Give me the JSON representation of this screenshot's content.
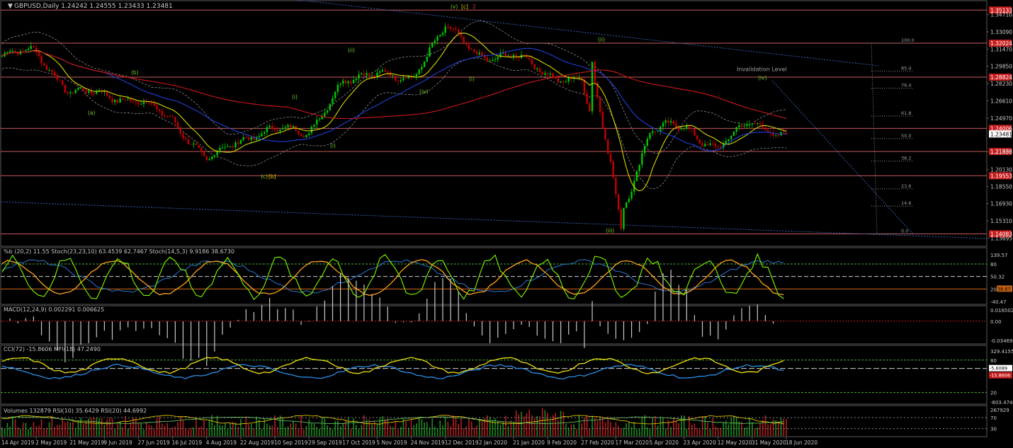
{
  "colors": {
    "background": "#000000",
    "frame": "#5a5a5a",
    "text": "#c8c8c8",
    "level_line": "#c85a5a",
    "level_label_bg": "#c81e1e",
    "price_tag_bg": "#ffffff",
    "price_tag_fg": "#000000",
    "bull_candle": "#00c800",
    "bear_candle": "#c80000",
    "ma_fast": "#d9d900",
    "ma_mid": "#2040d8",
    "ma_slow": "#d01818",
    "trendline": "#3a5fb4",
    "bollinger": "#a0a0a0",
    "stoch_main": "#ffa31a",
    "stoch_fast": "#7cfc00",
    "bband_pct": "#2a78d0",
    "ob_os_line": "#4caf2f",
    "macd_hist": "#c8c8c8",
    "macd_signal": "#d01818",
    "cci": "#2a8fe8",
    "mfi": "#f0e010",
    "vol_green": "#1e8c1e",
    "vol_red": "#b41e1e",
    "wave_label": "#79c92e",
    "wave_label_bracket": "#e0d000",
    "wave_label_red": "#e03030"
  },
  "main": {
    "header_icon": "dropdown-triangle-icon",
    "header": "GBPUSD,Daily  1.24242 1.24555 1.23433 1.23481",
    "y_axis_ticks": [
      "1.34710",
      "1.33090",
      "1.31470",
      "1.29850",
      "1.28230",
      "1.26610",
      "1.24970",
      "1.23481",
      "1.21800",
      "1.20130",
      "1.18550",
      "1.16930",
      "1.15310",
      "1.13695"
    ],
    "level_labels": [
      "1.35133",
      "1.32024",
      "1.28824",
      "1.24006",
      "1.21836",
      "1.19553",
      "1.14083"
    ],
    "current_price": "1.23481",
    "fib_labels": [
      "100.0",
      "85.4",
      "76.4",
      "61.8",
      "50.0",
      "38.2",
      "23.6",
      "14.6",
      "0.0"
    ],
    "invalidation_label": "Invalidation Level",
    "wave_labels": {
      "c_b_lbl": "(c)",
      "c_b_bracket": "[b]",
      "v_top_lbl": "(v)",
      "v_top_bracket": "[c]",
      "v_top_num": "2",
      "a": "(a)",
      "b": "(b)",
      "i1": "(i)",
      "i2": "(i)",
      "ii1": "(ii)",
      "iv1": "(iv)",
      "i3": "(i)",
      "ii_cov": "(ii)",
      "iii": "(iii)",
      "iv2": "(iv)",
      "i4": "(i)"
    }
  },
  "stoch_panel": {
    "header": "%b (20,2) 11.55  Stoch(23,23,10) 63.4539 62.7467  Stoch(14,5,3) 9.9186 38.6730",
    "y_ticks": [
      "139.57",
      "80",
      "50.32",
      "20",
      "-40.47"
    ],
    "value_tag": "38.67"
  },
  "macd_panel": {
    "header": "MACD(12,24,9) 0.002291 0.006625",
    "y_ticks": [
      "0.016502",
      "0.00",
      "-0.034699"
    ]
  },
  "cci_panel": {
    "header": "CCI(72) -15.8606  MFI(18) 47.2490",
    "y_ticks": [
      "329.4155",
      "80",
      "20",
      "-603.4746"
    ],
    "value_tags": [
      "-5.6089",
      "-15.8606"
    ]
  },
  "volume_panel": {
    "header": "Volumes 132879  RSI(10) 35.6429  RSI(20) 44.6992",
    "y_ticks": [
      "267929",
      "70",
      "30"
    ]
  },
  "x_axis_labels": [
    "14 Apr 2019",
    "2 May 2019",
    "21 May 2019",
    "9 Jun 2019",
    "27 Jun 2019",
    "16 Jul 2019",
    "4 Aug 2019",
    "22 Aug 2019",
    "10 Sep 2019",
    "29 Sep 2019",
    "17 Oct 2019",
    "5 Nov 2019",
    "24 Nov 2019",
    "12 Dec 2019",
    "2 Jan 2020",
    "21 Jan 2020",
    "9 Feb 2020",
    "27 Feb 2020",
    "17 Mar 2020",
    "5 Apr 2020",
    "23 Apr 2020",
    "12 May 2020",
    "31 May 2020",
    "18 Jun 2020"
  ],
  "chart_data": {
    "type": "candlestick",
    "symbol": "GBPUSD",
    "timeframe": "Daily",
    "last_bar": {
      "open": 1.24242,
      "high": 1.24555,
      "low": 1.23433,
      "close": 1.23481
    },
    "ylim": [
      1.1305,
      1.3575
    ],
    "horizontal_levels": [
      1.35133,
      1.32024,
      1.28824,
      1.24006,
      1.21836,
      1.19553,
      1.14083
    ],
    "fib_retracement": {
      "levels": [
        100.0,
        85.4,
        76.4,
        61.8,
        50.0,
        38.2,
        23.6,
        14.6,
        0.0
      ],
      "from": 1.1408,
      "to": 1.3202
    },
    "close_path": [
      [
        "14 Apr 2019",
        1.308
      ],
      [
        "2 May 2019",
        1.312
      ],
      [
        "21 May 2019",
        1.275
      ],
      [
        "9 Jun 2019",
        1.27
      ],
      [
        "27 Jun 2019",
        1.269
      ],
      [
        "16 Jul 2019",
        1.244
      ],
      [
        "4 Aug 2019",
        1.215
      ],
      [
        "22 Aug 2019",
        1.224
      ],
      [
        "10 Sep 2019",
        1.246
      ],
      [
        "29 Sep 2019",
        1.23
      ],
      [
        "17 Oct 2019",
        1.29
      ],
      [
        "5 Nov 2019",
        1.288
      ],
      [
        "24 Nov 2019",
        1.29
      ],
      [
        "12 Dec 2019",
        1.333
      ],
      [
        "2 Jan 2020",
        1.31
      ],
      [
        "21 Jan 2020",
        1.307
      ],
      [
        "9 Feb 2020",
        1.292
      ],
      [
        "27 Feb 2020",
        1.285
      ],
      [
        "17 Mar 2020",
        1.148
      ],
      [
        "5 Apr 2020",
        1.236
      ],
      [
        "23 Apr 2020",
        1.243
      ],
      [
        "12 May 2020",
        1.221
      ],
      [
        "31 May 2020",
        1.246
      ],
      [
        "18 Jun 2020",
        1.2348
      ]
    ],
    "indicators": [
      "MA yellow",
      "MA blue",
      "MA red (200)",
      "Bollinger Bands"
    ]
  }
}
